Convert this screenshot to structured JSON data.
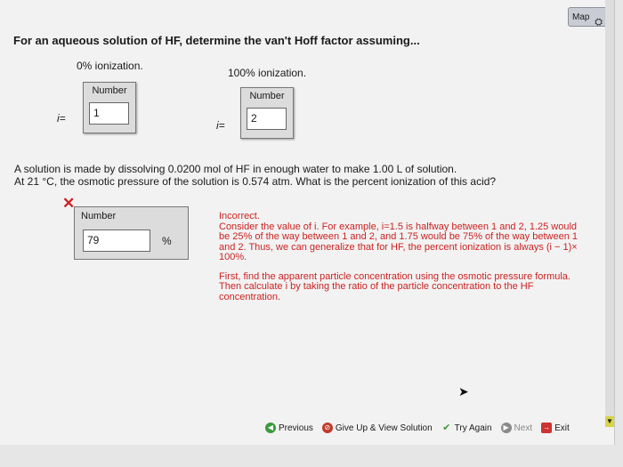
{
  "header": {
    "map_label": "Map"
  },
  "question": "For an aqueous solution of HF, determine the van't Hoff factor assuming...",
  "columns": [
    {
      "heading": "0% ionization.",
      "box_label": "Number",
      "i_label": "i=",
      "value": "1"
    },
    {
      "heading": "100% ionization.",
      "box_label": "Number",
      "i_label": "i=",
      "value": "2"
    }
  ],
  "problem": {
    "line1": "A solution is made by dissolving 0.0200 mol of HF in enough water to make 1.00 L of solution.",
    "line2": "At 21 °C, the osmotic pressure of the solution is 0.574 atm. What is the percent ionization of this acid?"
  },
  "answer": {
    "box_label": "Number",
    "value": "79",
    "unit": "%"
  },
  "feedback": {
    "status": "Incorrect.",
    "hint1": "Consider the value of i. For example, i=1.5 is halfway between 1 and 2, 1.25 would be 25% of the way between 1 and 2, and 1.75 would be 75% of the way between 1 and 2. Thus, we can generalize that for HF, the percent ionization is always (i − 1)× 100%.",
    "hint2": "First, find the apparent particle concentration using the osmotic pressure formula. Then calculate i by taking the ratio of the particle concentration to the HF concentration."
  },
  "toolbar": {
    "previous": "Previous",
    "give_up": "Give Up & View Solution",
    "try_again": "Try Again",
    "next": "Next",
    "exit": "Exit"
  },
  "colors": {
    "feedback": "#cc2222",
    "background": "#f2f2f2"
  }
}
